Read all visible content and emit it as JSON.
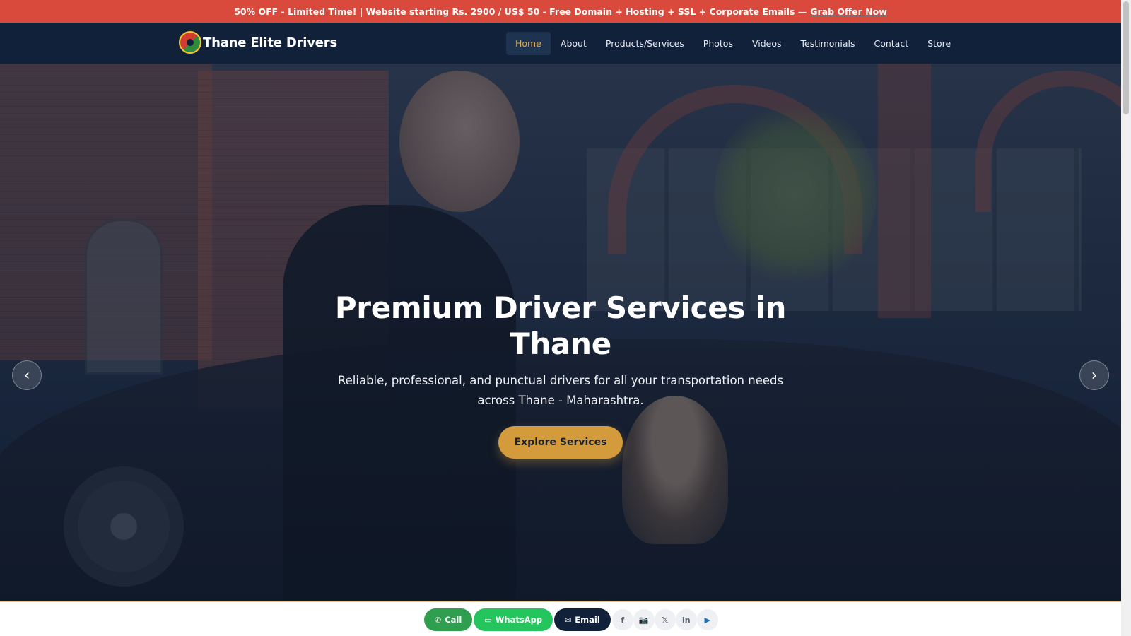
{
  "promo": {
    "text": "50% OFF - Limited Time! | Website starting Rs. 2900 / US$ 50 - Free Domain + Hosting + SSL + Corporate Emails —",
    "link": "Grab Offer Now"
  },
  "brand": {
    "name": "Thane Elite Drivers",
    "logo_icon": "logo-icon"
  },
  "nav": {
    "items": [
      "Home",
      "About",
      "Products/Services",
      "Photos",
      "Videos",
      "Testimonials",
      "Contact",
      "Store"
    ],
    "active": "Home"
  },
  "hero": {
    "title": "Premium Driver Services in Thane",
    "subtitle": "Reliable, professional, and punctual drivers for all your transportation needs across Thane - Maharashtra.",
    "cta": "Explore Services",
    "prev_arrow": "‹",
    "next_arrow": "›"
  },
  "contact_bar": {
    "call": "Call",
    "whatsapp": "WhatsApp",
    "email": "Email",
    "social": [
      "f",
      "📷",
      "𝕏",
      "in",
      "▶"
    ]
  },
  "colors": {
    "promo_bg": "#d9493c",
    "nav_bg": "#11213a",
    "accent": "#d39b3c",
    "active_nav_text": "#e0a84a",
    "call_green": "#2f9e4f",
    "whatsapp_green": "#25c55e"
  }
}
